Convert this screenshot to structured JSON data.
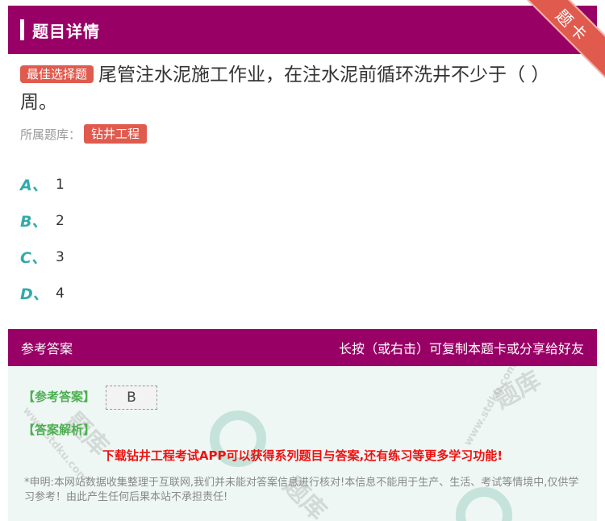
{
  "header": {
    "title": "题目详情"
  },
  "ribbon": {
    "label": "题卡"
  },
  "question": {
    "type_badge": "最佳选择题",
    "text": "尾管注水泥施工作业，在注水泥前循环洗井不少于（ ）周。",
    "bank_label": "所属题库：",
    "bank_name": "钻井工程"
  },
  "options": [
    {
      "letter": "A、",
      "text": "1"
    },
    {
      "letter": "B、",
      "text": "2"
    },
    {
      "letter": "C、",
      "text": "3"
    },
    {
      "letter": "D、",
      "text": "4"
    }
  ],
  "answer_bar": {
    "left": "参考答案",
    "right": "长按（或右击）可复制本题卡或分享给好友"
  },
  "answer": {
    "ref_label": "【参考答案】",
    "ref_value": "B",
    "analysis_label": "【答案解析】",
    "download_text": "下载钻井工程考试APP可以获得系列题目与答案,还有练习等更多学习功能!",
    "disclaimer": "*申明:本网站数据收集整理于互联网,我们并未能对答案信息进行核对!本信息不能用于生产、生活、考试等情境中,仅供学习参考！由此产生任何后果本站不承担责任!"
  },
  "watermark": {
    "text": "www.stdku.com",
    "brand": "题库"
  },
  "colors": {
    "primary": "#990066",
    "accent": "#e05a4e",
    "option": "#33aaaa",
    "panel": "#eef7f4"
  }
}
